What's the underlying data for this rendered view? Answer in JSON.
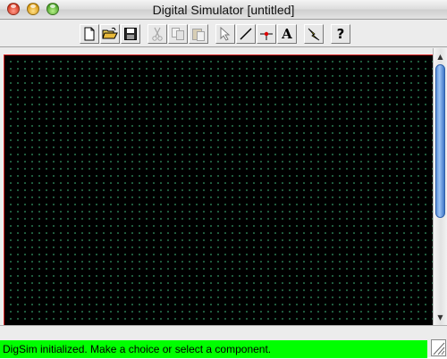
{
  "window": {
    "title": "Digital Simulator [untitled]"
  },
  "toolbar": {
    "buttons": [
      {
        "icon": "new-file-icon",
        "enabled": true
      },
      {
        "icon": "open-folder-icon",
        "enabled": true
      },
      {
        "icon": "save-disk-icon",
        "enabled": true
      },
      {
        "icon": "cut-scissors-icon",
        "enabled": false
      },
      {
        "icon": "copy-icon",
        "enabled": false
      },
      {
        "icon": "paste-icon",
        "enabled": false
      },
      {
        "icon": "select-arrow-icon",
        "enabled": true
      },
      {
        "icon": "wire-line-icon",
        "enabled": true
      },
      {
        "icon": "connection-dot-icon",
        "enabled": true
      },
      {
        "icon": "text-label-icon",
        "enabled": true
      },
      {
        "icon": "simulate-lightning-icon",
        "enabled": true
      },
      {
        "icon": "help-question-icon",
        "enabled": true
      }
    ],
    "help_label": "?",
    "text_label": "A"
  },
  "canvas": {
    "background": "#000000",
    "grid_dot_color": "#2f8a5c",
    "border_color": "#dd2222"
  },
  "status": {
    "message": "DigSim initialized. Make a choice or select a component.",
    "background": "#00ff00"
  }
}
